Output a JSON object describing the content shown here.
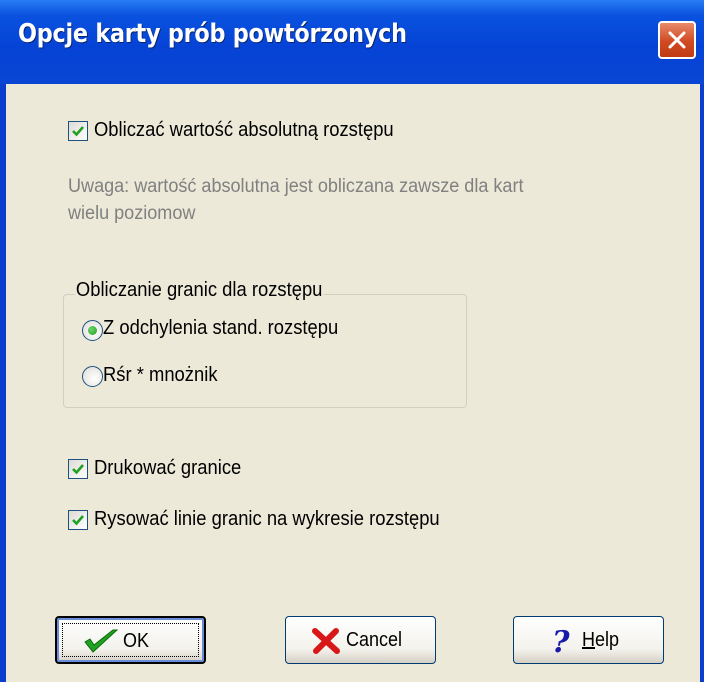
{
  "window": {
    "title": "Opcje karty prób powtórzonych"
  },
  "options": {
    "absolute_value": {
      "label": "Obliczać wartość absolutną rozstępu",
      "checked": true
    },
    "note": "Uwaga: wartość absolutna jest obliczana zawsze dla kart wielu poziomow"
  },
  "limits_group": {
    "title": "Obliczanie granic dla rozstępu",
    "radio_std": {
      "label": "Z odchylenia stand. rozstępu",
      "selected": true
    },
    "radio_mult": {
      "label": "Rśr * mnożnik",
      "selected": false
    }
  },
  "print_limits": {
    "label": "Drukować granice",
    "checked": true
  },
  "draw_limits": {
    "label": "Rysować linie granic na wykresie rozstępu",
    "checked": true
  },
  "buttons": {
    "ok": "OK",
    "cancel": "Cancel",
    "help": "Help"
  },
  "colors": {
    "title_bar": "#0a52df",
    "dialog_bg": "#ece9d8",
    "check_green": "#21a121",
    "cancel_red": "#d81818",
    "help_blue": "#1a1aa8"
  },
  "icons": {
    "close": "close-icon",
    "checkmark": "checkmark-icon",
    "ok": "ok-check-icon",
    "cancel": "cancel-x-icon",
    "help": "help-question-icon"
  }
}
